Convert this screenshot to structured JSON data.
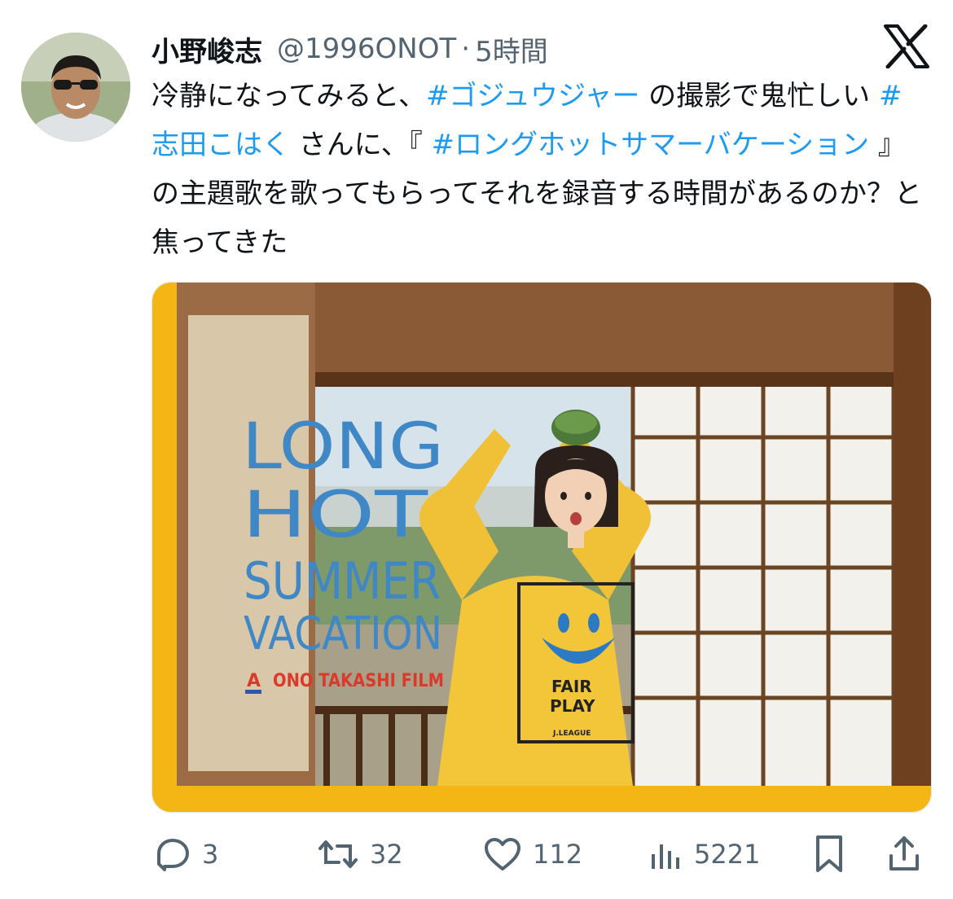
{
  "author": {
    "display_name": "小野峻志",
    "handle": "@1996ONOT",
    "separator": "·",
    "time": "5時間"
  },
  "tweet": {
    "segments": [
      {
        "text": "冷静になってみると、",
        "type": "text"
      },
      {
        "text": "#ゴジュウジャー",
        "type": "hashtag"
      },
      {
        "text": " の撮影で鬼忙しい ",
        "type": "text"
      },
      {
        "text": "#志田こはく",
        "type": "hashtag"
      },
      {
        "text": " さんに、『 ",
        "type": "text"
      },
      {
        "text": "#ロングホットサマーバケーション",
        "type": "hashtag"
      },
      {
        "text": " 』の主題歌を歌ってもらってそれを録音する時間があるのか？と焦ってきた",
        "type": "text"
      }
    ]
  },
  "media": {
    "poster_title": [
      "LONG",
      "HOT",
      "SUMMER",
      "VACATION"
    ],
    "credit": "ONO TAKASHI FILM",
    "credit_mark": "A",
    "shirt_text": [
      "FAIR",
      "PLAY"
    ],
    "shirt_small": "J.LEAGUE"
  },
  "actions": {
    "replies": "3",
    "reposts": "32",
    "likes": "112",
    "views": "5221"
  },
  "colors": {
    "hashtag": "#1d9bf0",
    "secondary_text": "#536471",
    "poster_yellow": "#f4b614",
    "title_blue": "#3f88c5",
    "credit_red": "#d93a2b"
  },
  "icons": [
    "x-logo-icon",
    "reply-icon",
    "repost-icon",
    "like-icon",
    "views-icon",
    "bookmark-icon",
    "share-icon"
  ]
}
